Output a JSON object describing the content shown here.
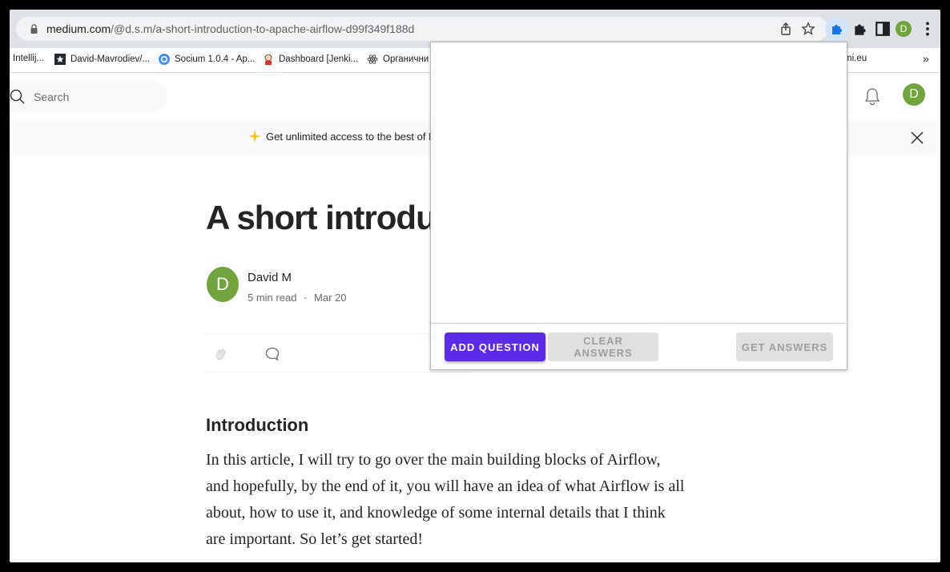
{
  "browser": {
    "url_host": "medium.com",
    "url_path": "/@d.s.m/a-short-introduction-to-apache-airflow-d99f349f188d",
    "profile_initial": "D",
    "bookmarks": [
      {
        "label": "Intellij...",
        "icon": "bookmark-icon"
      },
      {
        "label": "David-Mavrodiev/...",
        "icon": "star-square-icon"
      },
      {
        "label": "Socium 1.0.4 - Ap...",
        "icon": "socium-icon"
      },
      {
        "label": "Dashboard [Jenki...",
        "icon": "jenkins-icon"
      },
      {
        "label": "Органични",
        "icon": "atom-icon"
      },
      {
        "label": "mi.eu",
        "icon": "bookmark-icon"
      }
    ],
    "bookmarks_overflow": "»"
  },
  "medium": {
    "search_placeholder": "Search",
    "avatar_initial": "D",
    "banner_text": "Get unlimited access to the best of Me"
  },
  "article": {
    "title": "A short introducti",
    "author_initial": "D",
    "author_name": "David M",
    "read_time": "5 min read",
    "separator": "·",
    "date": "Mar 20",
    "section_heading": "Introduction",
    "paragraph": "In this article, I will try to go over the main building blocks of Airflow, and hopefully, by the end of it, you will have an idea of what Airflow is all about, how to use it, and knowledge of some internal details that I think are important. So let’s get started!"
  },
  "popup": {
    "add_question": "ADD QUESTION",
    "clear_answers": "CLEAR ANSWERS",
    "get_answers": "GET ANSWERS"
  },
  "colors": {
    "primary_button": "#5b2be8",
    "avatar_green": "#71a33f",
    "sparkle": "#ffc017"
  }
}
